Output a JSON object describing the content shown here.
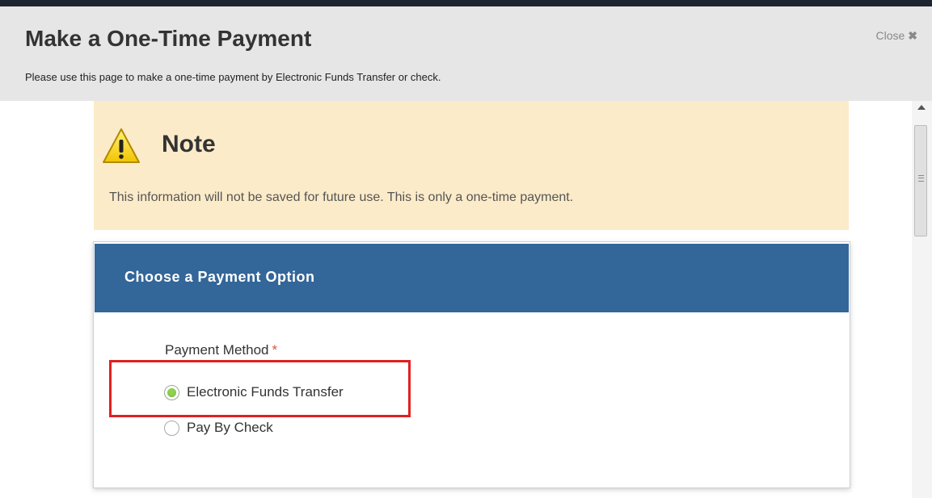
{
  "header": {
    "title": "Make a One-Time Payment",
    "subtitle": "Please use this page to make a one-time payment by Electronic Funds Transfer or check.",
    "close_label": "Close",
    "close_icon": "close-x-icon"
  },
  "note": {
    "icon": "warning-icon",
    "title": "Note",
    "text": "This information will not be saved for future use. This is only a one-time payment."
  },
  "payment_card": {
    "title": "Choose a Payment Option",
    "field_label": "Payment Method",
    "required_marker": "*",
    "options": [
      {
        "label": "Electronic Funds Transfer",
        "selected": true
      },
      {
        "label": "Pay By Check",
        "selected": false
      }
    ]
  },
  "colors": {
    "header_bg": "#e6e6e6",
    "note_bg": "#fcebc9",
    "card_header_bg": "#336699",
    "radio_selected": "#8fd14f",
    "required": "#e0533b",
    "annotation": "#e02020"
  }
}
